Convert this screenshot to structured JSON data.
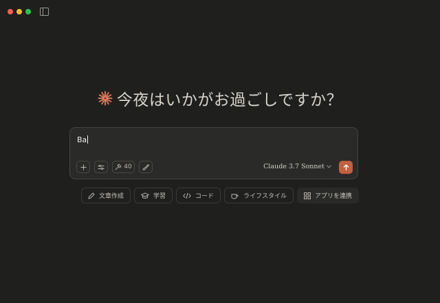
{
  "window": {
    "buttons": [
      "close",
      "minimize",
      "zoom"
    ],
    "sidebar_icon": "sidebar-toggle-icon"
  },
  "greeting": {
    "icon": "claude-spark-icon",
    "icon_color": "#d97757",
    "text": "今夜はいかがお過ごしですか？"
  },
  "composer": {
    "input_value": "Ba",
    "tools": {
      "add_icon": "plus-icon",
      "settings_icon": "sliders-icon",
      "tools_count": "40",
      "tools_icon": "hammer-icon",
      "brush_icon": "brush-icon"
    },
    "model": "Claude 3.7 Sonnet",
    "send_icon": "arrow-up-icon",
    "accent": "#c2603f"
  },
  "suggestions": [
    {
      "icon": "pencil-icon",
      "label": "文章作成"
    },
    {
      "icon": "graduation-cap-icon",
      "label": "学習"
    },
    {
      "icon": "code-icon",
      "label": "コード"
    },
    {
      "icon": "coffee-icon",
      "label": "ライフスタイル"
    },
    {
      "icon": "grid-icon",
      "label": "アプリを連携"
    }
  ]
}
